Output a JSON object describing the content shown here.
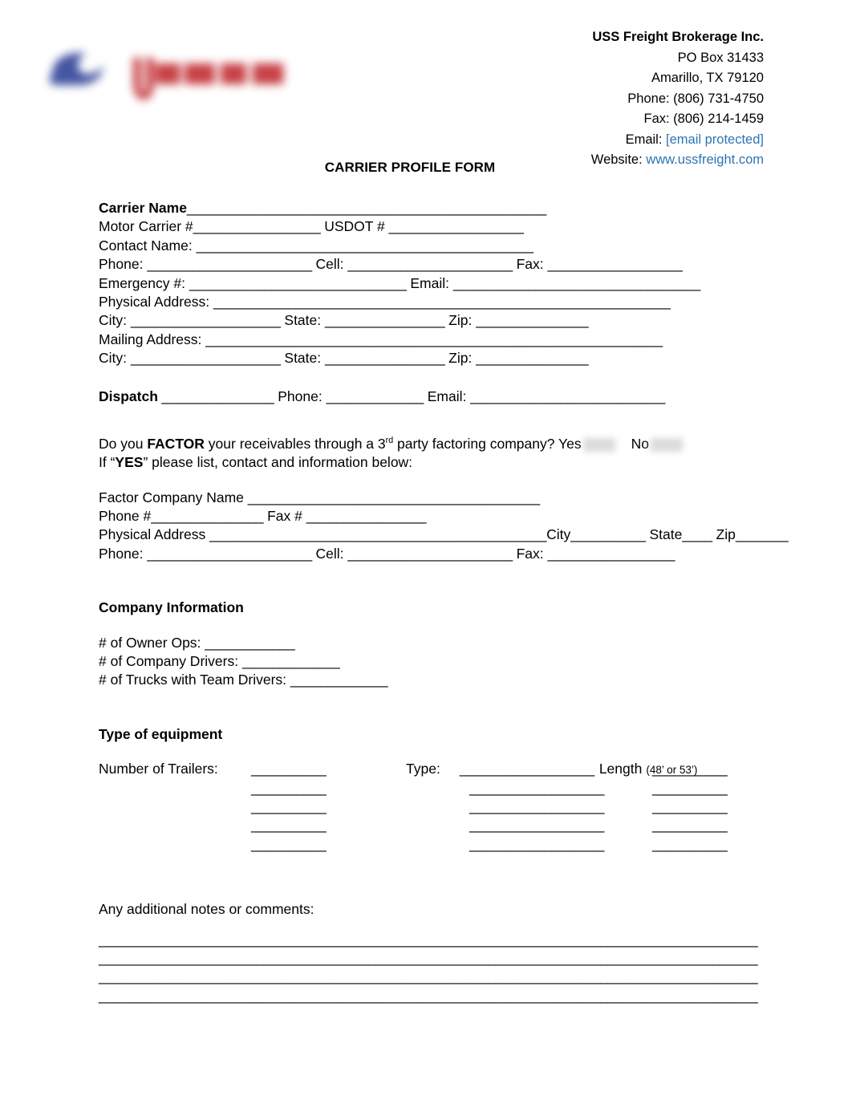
{
  "company": {
    "name": "USS Freight Brokerage Inc.",
    "po_box": "PO Box 31433",
    "city_state_zip": "Amarillo, TX  79120",
    "phone": "Phone: (806) 731-4750",
    "fax": "Fax: (806) 214-1459",
    "email_label": "Email: ",
    "email_value": "[email protected]",
    "website_label": "Website: ",
    "website_value": "www.ussfreight.com",
    "link_color": "#2e74b5",
    "logo_alt": "uss-freight-logo"
  },
  "title": "CARRIER PROFILE FORM",
  "carrier": {
    "carrier_name_label": "Carrier Name",
    "carrier_name_rule": "________________________________________________",
    "motor_carrier_label": "Motor Carrier #",
    "motor_carrier_rule": "_________________",
    "usdot_label": " USDOT # ",
    "usdot_rule": "__________________",
    "contact_name_label": "Contact Name: ",
    "contact_name_rule": "_____________________________________________",
    "phone_label": "Phone: ",
    "phone_rule": "______________________",
    "cell_label": " Cell: ",
    "cell_rule": "______________________",
    "fax_label": " Fax: ",
    "fax_rule": "__________________",
    "emergency_label": "Emergency #: ",
    "emergency_rule": "_____________________________",
    "email_label": " Email: ",
    "email_rule": "_________________________________",
    "physical_address_label": "Physical Address: ",
    "physical_address_rule": "_____________________________________________________________",
    "city_label": "City: ",
    "city_rule": "____________________",
    "state_label": " State: ",
    "state_rule": "________________",
    "zip_label": " Zip: ",
    "zip_rule": "_______________",
    "mailing_address_label": "Mailing Address: ",
    "mailing_address_rule": "_____________________________________________________________",
    "city2_label": "City: ",
    "city2_rule": "____________________",
    "state2_label": " State: ",
    "state2_rule": "________________",
    "zip2_label": " Zip: ",
    "zip2_rule": "_______________"
  },
  "dispatch": {
    "label": "Dispatch",
    "rule": " _______________",
    "phone_label": " Phone: ",
    "phone_rule": "_____________",
    "email_label": " Email: ",
    "email_rule": "__________________________"
  },
  "factor": {
    "question_pre": "Do you ",
    "question_bold": "FACTOR",
    "question_mid": " your receivables through a 3",
    "question_sup": "rd",
    "question_post": " party factoring company? Yes",
    "yes_label": "Yes",
    "no_label": "No",
    "yes_checkbox": "redacted-checkbox-yes",
    "no_checkbox": "redacted-checkbox-no",
    "if_yes_pre": "If “",
    "if_yes_bold": "YES",
    "if_yes_post": "” please list, contact and information below:",
    "company_name_label": "Factor Company Name ",
    "company_name_rule": "_______________________________________",
    "phone_label": "Phone #",
    "phone_rule": "_______________",
    "fax_label": " Fax # ",
    "fax_rule": "________________",
    "physical_address_label": "Physical Address ",
    "physical_address_rule": "_____________________________________________",
    "city_label": "City",
    "city_rule": "__________",
    "state_label": " State",
    "state_rule": "____",
    "zip_label": " Zip",
    "zip_rule": "_______",
    "phone2_label": "Phone: ",
    "phone2_rule": "______________________",
    "cell2_label": " Cell: ",
    "cell2_rule": "______________________",
    "fax2_label": " Fax: ",
    "fax2_rule": "_________________"
  },
  "company_info": {
    "heading": "Company Information",
    "owner_ops_label": "# of Owner Ops: ",
    "owner_ops_rule": "____________",
    "company_drivers_label": "# of Company Drivers: ",
    "company_drivers_rule": "_____________",
    "team_drivers_label": "# of Trucks with Team Drivers: ",
    "team_drivers_rule": "_____________"
  },
  "equipment": {
    "heading": "Type of equipment",
    "number_of_trailers_label": "Number of Trailers:",
    "type_label": "Type:",
    "length_label": "Length",
    "length_note": "(48’ or 53’)",
    "short_rule": "__________",
    "long_rule": "__________________",
    "rows": [
      {
        "a": "__________",
        "b": "__________________",
        "c": "__________"
      },
      {
        "a": "__________",
        "b": "__________________",
        "c": "__________"
      },
      {
        "a": "__________",
        "b": "__________________",
        "c": "__________"
      },
      {
        "a": "__________",
        "b": "__________________",
        "c": "__________"
      },
      {
        "a": "__________",
        "b": "__________________",
        "c": "__________"
      }
    ]
  },
  "notes": {
    "label": "Any additional notes or comments:",
    "lines": [
      "________________________________________________________________________________________",
      "________________________________________________________________________________________",
      "________________________________________________________________________________________",
      "________________________________________________________________________________________"
    ]
  }
}
